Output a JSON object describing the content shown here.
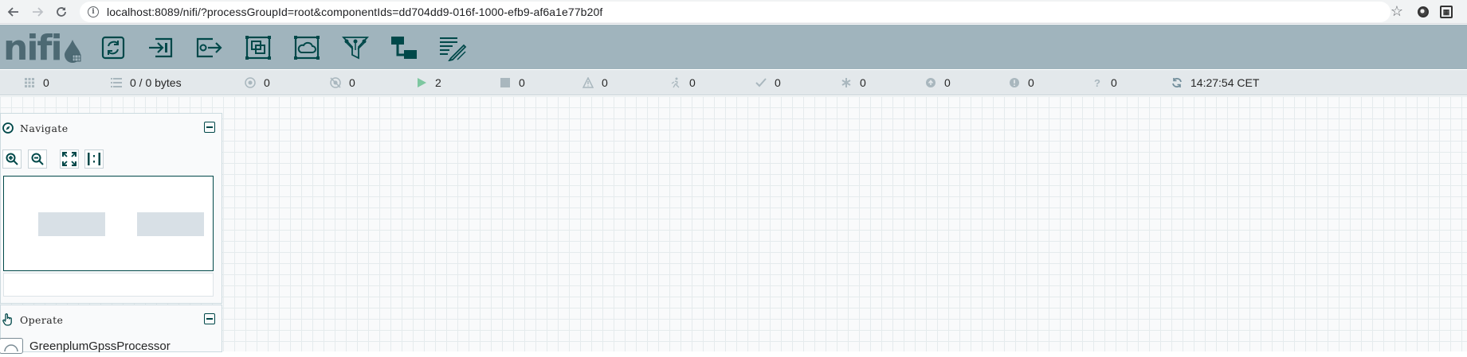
{
  "browser": {
    "url": "localhost:8089/nifi/?processGroupId=root&componentIds=dd704dd9-016f-1000-efb9-af6a1e77b20f",
    "back_icon": "arrow-left-icon",
    "forward_icon": "arrow-right-icon",
    "reload_icon": "reload-icon",
    "info_icon": "info-icon",
    "star_icon": "star-icon"
  },
  "header": {
    "logo_text": "nifi",
    "tools": [
      {
        "name": "processor-tool",
        "icon": "processor-icon"
      },
      {
        "name": "input-port-tool",
        "icon": "input-port-icon"
      },
      {
        "name": "output-port-tool",
        "icon": "output-port-icon"
      },
      {
        "name": "process-group-tool",
        "icon": "process-group-icon"
      },
      {
        "name": "remote-process-group-tool",
        "icon": "remote-process-group-icon"
      },
      {
        "name": "funnel-tool",
        "icon": "funnel-icon"
      },
      {
        "name": "template-tool",
        "icon": "template-icon"
      },
      {
        "name": "label-tool",
        "icon": "label-icon"
      }
    ]
  },
  "status": {
    "active_threads": "0",
    "queued": "0 / 0 bytes",
    "transmitting": "0",
    "not_transmitting": "0",
    "running": "2",
    "stopped": "0",
    "invalid": "0",
    "disabled": "0",
    "up_to_date": "0",
    "locally_modified": "0",
    "stale": "0",
    "locally_modified_stale": "0",
    "sync_failure": "0",
    "refreshed": "14:27:54 CET"
  },
  "colors": {
    "header_bg": "#a0b4bd",
    "status_bg": "#e3e8eb",
    "icon_dark": "#004849",
    "running_green": "#7dc7a0"
  },
  "navigate": {
    "title": "Navigate"
  },
  "operate": {
    "title": "Operate",
    "component_name": "GreenplumGpssProcessor"
  }
}
